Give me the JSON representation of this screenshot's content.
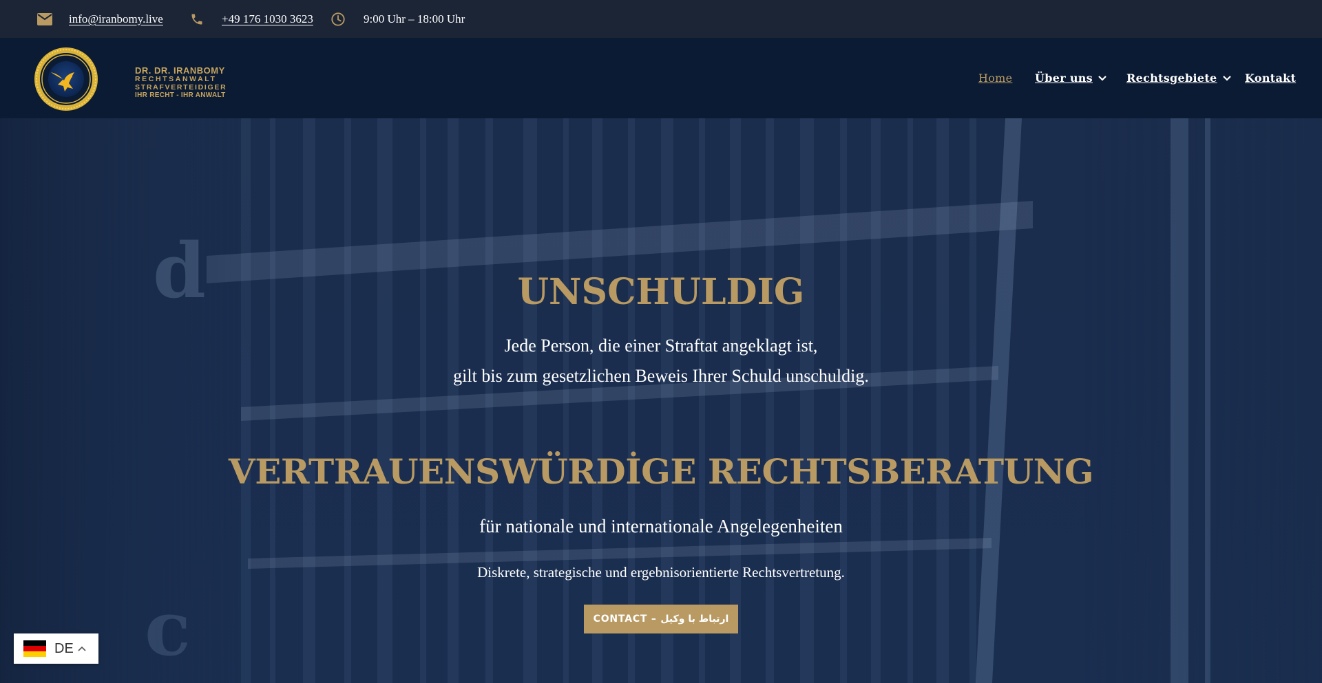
{
  "topbar": {
    "email": "info@iranbomy.live",
    "phone": "+49 176 1030 3623",
    "hours": "9:00 Uhr – 18:00 Uhr"
  },
  "brand": {
    "line1": "DR. DR. IRANBOMY",
    "line2": "RECHTSANWALT",
    "line3": "STRAFVERTEIDIGER",
    "line4": "IHR RECHT - IHR ANWALT"
  },
  "nav": {
    "items": [
      {
        "label": "Home",
        "active": true
      },
      {
        "label": "Über uns",
        "dropdown": true
      },
      {
        "label": "Rechtsgebiete",
        "dropdown": true
      },
      {
        "label": "Kontakt"
      }
    ]
  },
  "hero": {
    "title1": "UNSCHULDIG",
    "line1": "Jede Person, die einer Straftat angeklagt ist,",
    "line2": "gilt bis zum gesetzlichen Beweis Ihrer Schuld unschuldig.",
    "title2": "VERTRAUENSWÜRDİGE RECHTSBERATUNG",
    "subtitle": "für nationale und internationale Angelegenheiten",
    "tagline": "Diskrete, strategische und ergebnisorientierte Rechtsvertretung.",
    "cta_label": "CONTACT – ارتباط با وکیل"
  },
  "language": {
    "code": "DE"
  },
  "colors": {
    "gold": "#b99a63",
    "navy": "#0b1b33",
    "topbar": "#1c2536"
  }
}
